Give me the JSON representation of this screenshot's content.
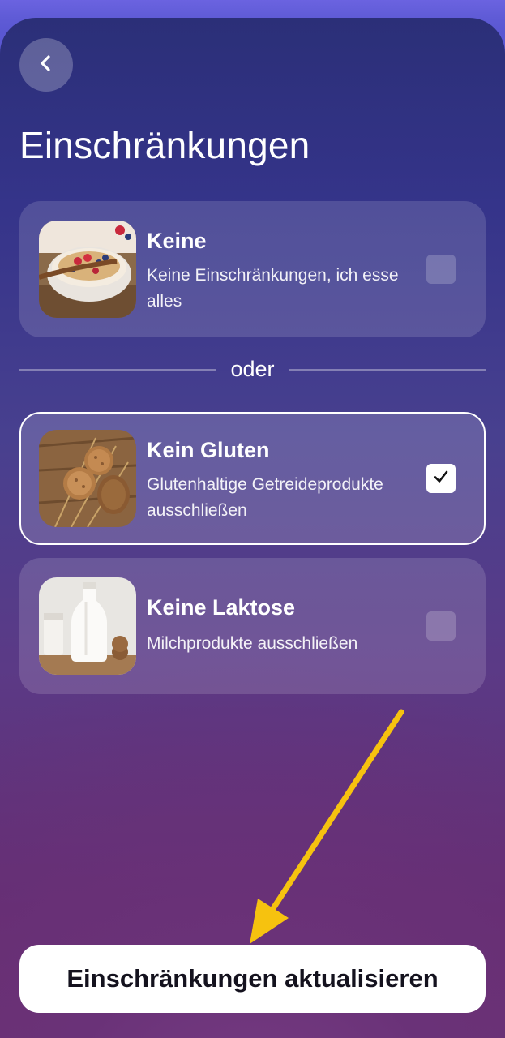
{
  "header": {
    "back_icon": "chevron-left-icon",
    "title": "Einschränkungen"
  },
  "options": [
    {
      "title": "Keine",
      "description": "Keine Einschränkungen, ich esse alles",
      "image": "breakfast-bowl-photo",
      "checked": false
    },
    {
      "title": "Kein Gluten",
      "description": "Glutenhaltige Getreideprodukte ausschließen",
      "image": "grain-bread-photo",
      "checked": true
    },
    {
      "title": "Keine Laktose",
      "description": "Milchprodukte ausschließen",
      "image": "milk-bottle-photo",
      "checked": false
    }
  ],
  "divider": {
    "label": "oder"
  },
  "annotation": {
    "arrow_color": "#f6c20f"
  },
  "footer": {
    "update_label": "Einschränkungen aktualisieren"
  },
  "colors": {
    "accent_white": "#ffffff",
    "background_top": "#2b2f78",
    "background_bottom": "#6b2f6e"
  }
}
